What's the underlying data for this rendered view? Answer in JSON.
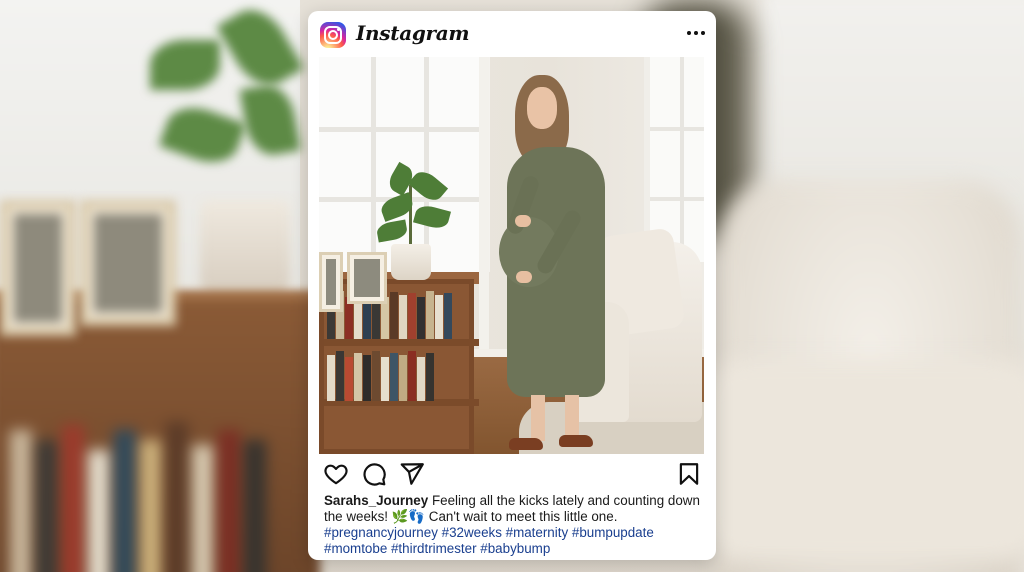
{
  "header": {
    "app_name": "Instagram",
    "logo_icon": "instagram-logo-icon",
    "menu_icon": "more-options-icon"
  },
  "actions": {
    "like_icon": "heart-icon",
    "comment_icon": "comment-bubble-icon",
    "share_icon": "paper-plane-icon",
    "save_icon": "bookmark-icon"
  },
  "caption": {
    "username": "Sarahs_Journey",
    "text": "Feeling all the kicks lately and counting down the weeks! 🌿👣 Can't wait to meet this little one.",
    "hashtags_line1": "#pregnancyjourney #32weeks #maternity #bumpupdate",
    "hashtags_line2": "#momtobe #thirdtrimester #babybump"
  },
  "colors": {
    "card_background": "#ffffff",
    "hashtag_color": "#1a3f8f",
    "text_color": "#1a1a1a"
  }
}
